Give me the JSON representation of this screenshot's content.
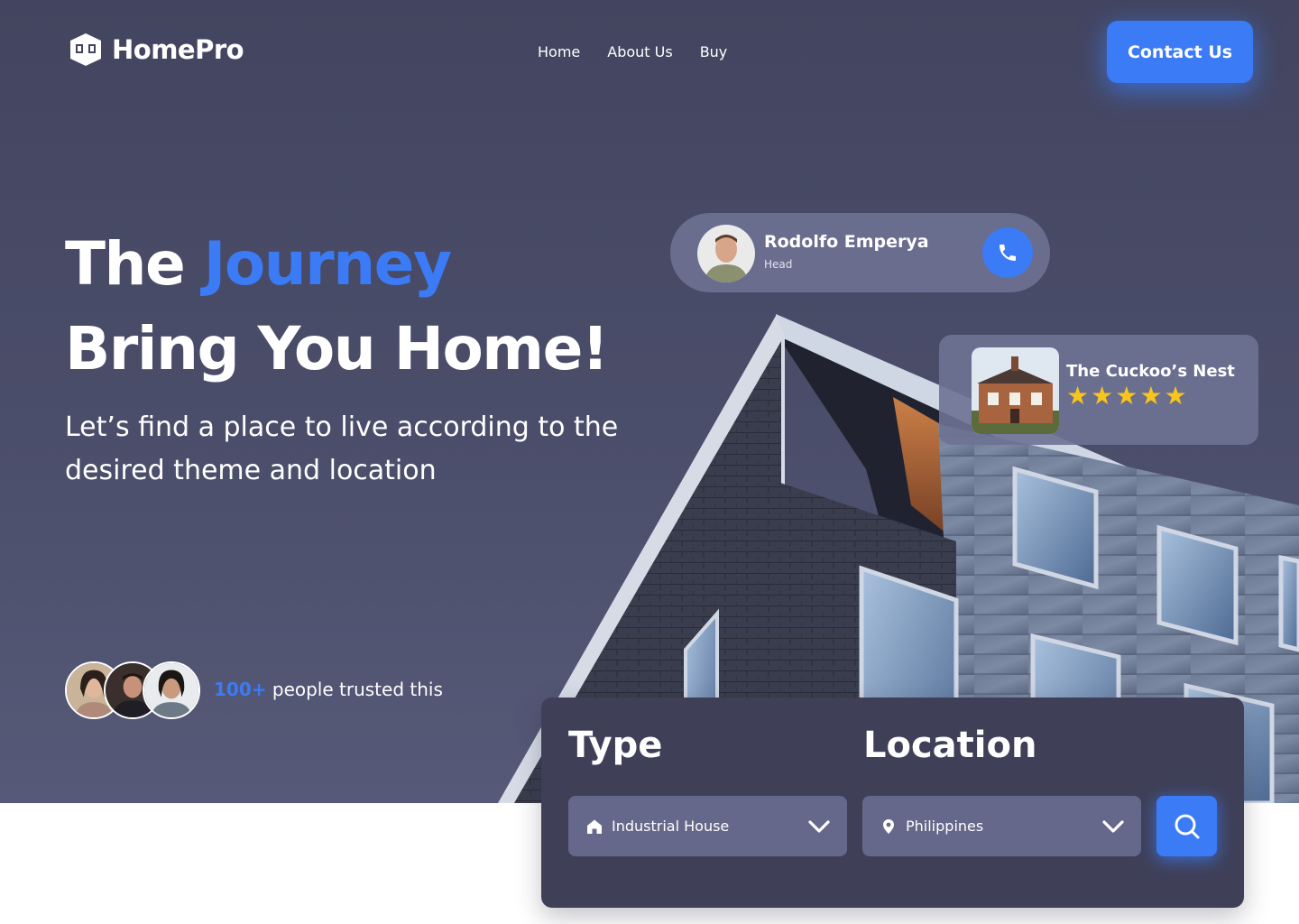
{
  "brand": {
    "name": "HomePro"
  },
  "nav": {
    "items": [
      "Home",
      "About Us",
      "Buy"
    ]
  },
  "header": {
    "contact_label": "Contact Us"
  },
  "hero": {
    "title_part1": "The",
    "title_accent": "Journey",
    "title_line2": "Bring You Home!",
    "subtitle": "Let’s find a place to live according to the desired theme and location"
  },
  "agent": {
    "name": "Rodolfo Emperya",
    "role": "Head"
  },
  "property": {
    "name": "The Cuckoo’s Nest",
    "rating": 5,
    "max_rating": 5
  },
  "trust": {
    "count": "100+",
    "text": " people trusted this"
  },
  "search": {
    "type_label": "Type",
    "type_value": "Industrial House",
    "location_label": "Location",
    "location_value": "Philippines"
  },
  "icons": {
    "logo": "home-logo-icon",
    "phone": "phone-icon",
    "house": "house-icon",
    "pin": "location-pin-icon",
    "chevron": "chevron-down-icon",
    "search": "search-icon",
    "star": "star-icon"
  },
  "colors": {
    "accent": "#3b7bf6",
    "star": "#f7c51b",
    "hero_bg": "#474a66",
    "panel_bg": "#3f4058",
    "select_bg": "#65688a"
  }
}
